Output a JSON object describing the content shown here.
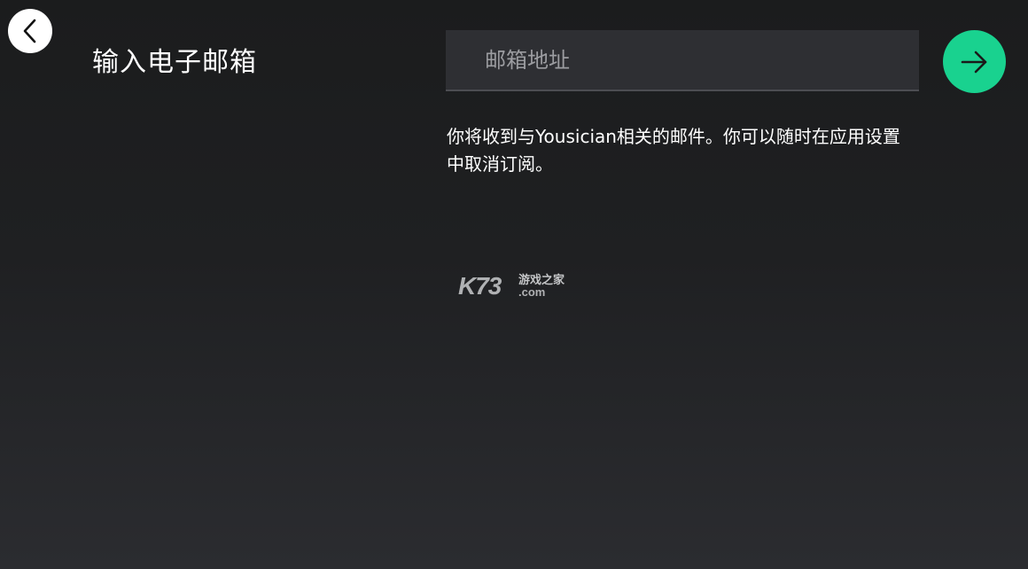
{
  "nav": {
    "back_icon": "chevron-left-icon"
  },
  "header": {
    "title": "输入电子邮箱"
  },
  "form": {
    "email_placeholder": "邮箱地址",
    "email_value": "",
    "submit_icon": "arrow-right-icon",
    "consent_text": "你将收到与Yousician相关的邮件。你可以随时在应用设置中取消订阅。"
  },
  "watermark": {
    "logo_text": "K73",
    "tagline": "游戏之家",
    "domain": ".com"
  },
  "colors": {
    "accent": "#19d28f",
    "background": "#1f2022",
    "input_background": "#2e2f33",
    "text": "#ffffff",
    "placeholder": "#9c9da1"
  }
}
